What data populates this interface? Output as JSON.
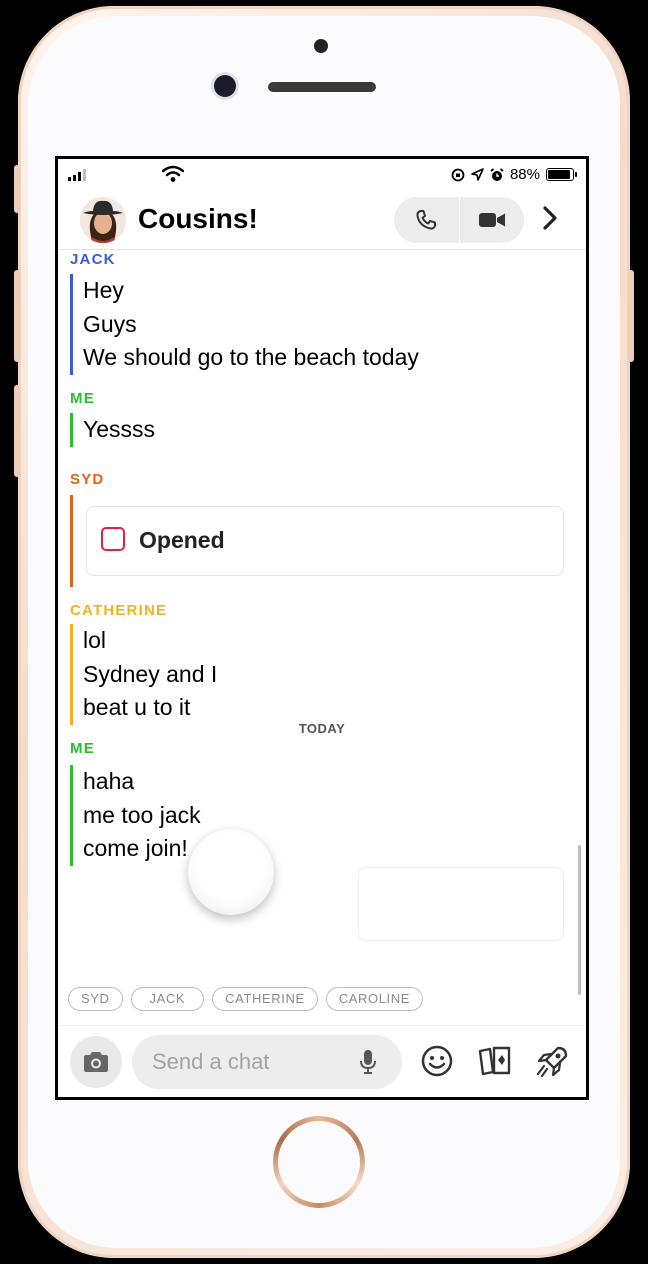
{
  "status_bar": {
    "battery": "88%"
  },
  "header": {
    "title": "Cousins!"
  },
  "messages": [
    {
      "sender": "JACK",
      "color": "#3b5bdb",
      "lines": [
        "Hey",
        "Guys",
        "We should go to the beach today"
      ]
    },
    {
      "sender": "ME",
      "color": "#2bc02b",
      "lines": [
        "Yessss"
      ]
    },
    {
      "sender": "SYD",
      "color": "#e0641b",
      "card": {
        "label": "Opened"
      }
    },
    {
      "sender": "CATHERINE",
      "color": "#f0b319",
      "lines": [
        "lol",
        "Sydney and I",
        "beat u to it"
      ]
    },
    {
      "sender": "ME",
      "color": "#2bc02b",
      "lines": [
        "haha",
        "me too jack",
        "come join!"
      ]
    }
  ],
  "today_label": "TODAY",
  "chips": [
    "SYD",
    "JACK",
    "CATHERINE",
    "CAROLINE"
  ],
  "input": {
    "placeholder": "Send a chat"
  },
  "icons": [
    "camera-icon",
    "microphone-icon",
    "emoji-icon",
    "cards-icon",
    "rocket-icon",
    "phone-icon",
    "video-icon",
    "chevron-right-icon"
  ]
}
